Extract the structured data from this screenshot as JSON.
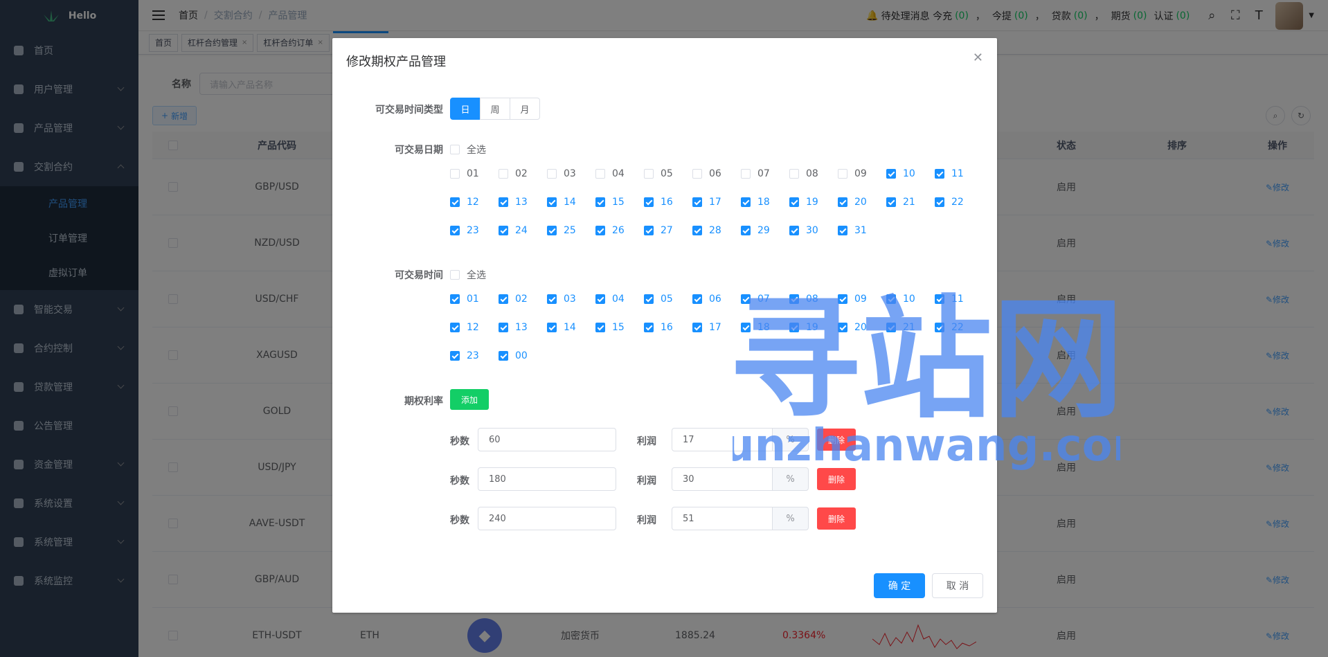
{
  "sidebar": {
    "logo_text": "Hello",
    "items": [
      {
        "label": "首页",
        "icon": "dashboard-icon",
        "expandable": false
      },
      {
        "label": "用户管理",
        "icon": "user-icon",
        "expandable": true
      },
      {
        "label": "产品管理",
        "icon": "document-icon",
        "expandable": true
      },
      {
        "label": "交割合约",
        "icon": "edit-icon",
        "expandable": true,
        "expanded": true
      },
      {
        "label": "智能交易",
        "icon": "gear-icon",
        "expandable": true
      },
      {
        "label": "合约控制",
        "icon": "chart-icon",
        "expandable": true
      },
      {
        "label": "贷款管理",
        "icon": "money-icon",
        "expandable": true
      },
      {
        "label": "公告管理",
        "icon": "message-icon",
        "expandable": false
      },
      {
        "label": "资金管理",
        "icon": "wallet-icon",
        "expandable": true
      },
      {
        "label": "系统设置",
        "icon": "settings-icon",
        "expandable": true
      },
      {
        "label": "系统管理",
        "icon": "system-icon",
        "expandable": true
      },
      {
        "label": "系统监控",
        "icon": "monitor-icon",
        "expandable": true
      }
    ],
    "sub_items": [
      "产品管理",
      "订单管理",
      "虚拟订单"
    ]
  },
  "navbar": {
    "breadcrumb": [
      "首页",
      "交割合约",
      "产品管理"
    ],
    "notice_label": "待处理消息 今充",
    "notice_count": "(0)",
    "withdraw_label": "今提",
    "withdraw_count": "(0)",
    "loan_label": "贷款",
    "loan_count": "(0)",
    "futures_label": "期货",
    "futures_count": "(0)",
    "auth_label": "认证",
    "auth_count": "(0)",
    "sep": "，"
  },
  "tags": [
    {
      "label": "首页",
      "closable": false
    },
    {
      "label": "杠杆合约管理",
      "closable": true
    },
    {
      "label": "杠杆合约订单",
      "closable": true
    },
    {
      "label": "",
      "closable": false,
      "active": true
    }
  ],
  "filter": {
    "label": "名称",
    "placeholder": "请输入产品名称"
  },
  "add_button": "新增",
  "table": {
    "headers": {
      "code": "产品代码",
      "status": "状态",
      "sort": "排序",
      "op": "操作"
    },
    "rows": [
      {
        "code": "GBP/USD",
        "status": "启用",
        "op": "修改"
      },
      {
        "code": "NZD/USD",
        "status": "启用",
        "op": "修改"
      },
      {
        "code": "USD/CHF",
        "status": "启用",
        "op": "修改"
      },
      {
        "code": "XAGUSD",
        "status": "启用",
        "op": "修改"
      },
      {
        "code": "GOLD",
        "status": "启用",
        "op": "修改"
      },
      {
        "code": "USD/JPY",
        "status": "启用",
        "op": "修改"
      },
      {
        "code": "AAVE-USDT",
        "status": "启用",
        "op": "修改"
      },
      {
        "code": "GBP/AUD",
        "status": "启用",
        "op": "修改"
      },
      {
        "code": "ETH-USDT",
        "status": "启用",
        "op": "修改",
        "symbol": "ETH",
        "category": "加密货币",
        "price": "1885.24",
        "change": "0.3364%"
      }
    ]
  },
  "dialog": {
    "title": "修改期权产品管理",
    "time_type_label": "可交易时间类型",
    "time_type_options": [
      "日",
      "周",
      "月"
    ],
    "time_type_selected": "日",
    "date_label": "可交易日期",
    "select_all": "全选",
    "dates": [
      {
        "v": "01",
        "on": false
      },
      {
        "v": "02",
        "on": false
      },
      {
        "v": "03",
        "on": false
      },
      {
        "v": "04",
        "on": false
      },
      {
        "v": "05",
        "on": false
      },
      {
        "v": "06",
        "on": false
      },
      {
        "v": "07",
        "on": false
      },
      {
        "v": "08",
        "on": false
      },
      {
        "v": "09",
        "on": false
      },
      {
        "v": "10",
        "on": true
      },
      {
        "v": "11",
        "on": true
      },
      {
        "v": "12",
        "on": true
      },
      {
        "v": "13",
        "on": true
      },
      {
        "v": "14",
        "on": true
      },
      {
        "v": "15",
        "on": true
      },
      {
        "v": "16",
        "on": true
      },
      {
        "v": "17",
        "on": true
      },
      {
        "v": "18",
        "on": true
      },
      {
        "v": "19",
        "on": true
      },
      {
        "v": "20",
        "on": true
      },
      {
        "v": "21",
        "on": true
      },
      {
        "v": "22",
        "on": true
      },
      {
        "v": "23",
        "on": true
      },
      {
        "v": "24",
        "on": true
      },
      {
        "v": "25",
        "on": true
      },
      {
        "v": "26",
        "on": true
      },
      {
        "v": "27",
        "on": true
      },
      {
        "v": "28",
        "on": true
      },
      {
        "v": "29",
        "on": true
      },
      {
        "v": "30",
        "on": true
      },
      {
        "v": "31",
        "on": true
      }
    ],
    "time_label": "可交易时间",
    "hours": [
      {
        "v": "01",
        "on": true
      },
      {
        "v": "02",
        "on": true
      },
      {
        "v": "03",
        "on": true
      },
      {
        "v": "04",
        "on": true
      },
      {
        "v": "05",
        "on": true
      },
      {
        "v": "06",
        "on": true
      },
      {
        "v": "07",
        "on": true
      },
      {
        "v": "08",
        "on": true
      },
      {
        "v": "09",
        "on": true
      },
      {
        "v": "10",
        "on": true
      },
      {
        "v": "11",
        "on": true
      },
      {
        "v": "12",
        "on": true
      },
      {
        "v": "13",
        "on": true
      },
      {
        "v": "14",
        "on": true
      },
      {
        "v": "15",
        "on": true
      },
      {
        "v": "16",
        "on": true
      },
      {
        "v": "17",
        "on": true
      },
      {
        "v": "18",
        "on": true
      },
      {
        "v": "19",
        "on": true
      },
      {
        "v": "20",
        "on": true
      },
      {
        "v": "21",
        "on": true
      },
      {
        "v": "22",
        "on": true
      },
      {
        "v": "23",
        "on": true
      },
      {
        "v": "00",
        "on": true
      }
    ],
    "rate_label": "期权利率",
    "add_label": "添加",
    "seconds_label": "秒数",
    "profit_label": "利润",
    "percent": "%",
    "delete_label": "删除",
    "rates": [
      {
        "seconds": "60",
        "profit": "17"
      },
      {
        "seconds": "180",
        "profit": "30"
      },
      {
        "seconds": "240",
        "profit": "51"
      }
    ],
    "confirm": "确 定",
    "cancel": "取 消"
  },
  "watermark": {
    "cn": "寻站网",
    "en": "xunzhanwang.com"
  },
  "colors": {
    "primary": "#1890ff",
    "success": "#13ce66",
    "danger": "#ff4949",
    "sidebar": "#304156"
  }
}
